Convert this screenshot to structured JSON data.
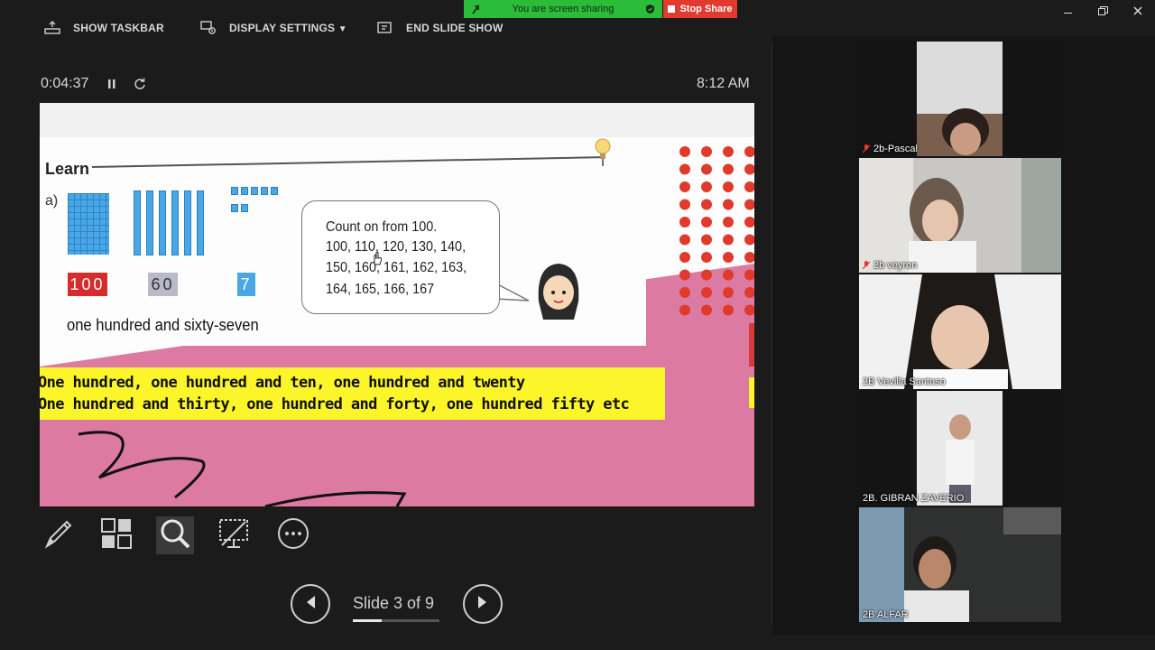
{
  "toolbar": {
    "show_taskbar": "SHOW TASKBAR",
    "display_settings": "DISPLAY SETTINGS",
    "display_settings_arrow": "▼",
    "end_slide_show": "END SLIDE SHOW"
  },
  "share": {
    "banner": "You are screen sharing",
    "stop": "Stop Share"
  },
  "timer": {
    "elapsed": "0:04:37",
    "clock": "8:12 AM"
  },
  "slide": {
    "learn": "Learn",
    "part": "a)",
    "card_hundreds": "100",
    "card_tens": "60",
    "card_ones": "7",
    "number_words": "one hundred and sixty-seven",
    "bubble": [
      "Count on from 100.",
      "100, 110, 120, 130, 140,",
      "150, 160, 161, 162, 163,",
      "164, 165, 166, 167"
    ],
    "banner_lines": [
      "One hundred, one hundred and ten, one hundred and twenty",
      "One hundred and thirty, one hundred and forty, one hundred fifty etc"
    ],
    "colors": {
      "pink": "#dc7aa2",
      "yellow": "#fbf52a",
      "blocks": "#4aa7e6"
    }
  },
  "controls": {
    "pen": "pen-icon",
    "grid": "see-all-slides-icon",
    "zoom": "zoom-icon",
    "screen": "screen-off-icon",
    "more": "more-options-icon"
  },
  "navigation": {
    "slide_label": "Slide 3 of 9",
    "current": 3,
    "total": 9
  },
  "participants": [
    {
      "name": "2b-Pascal",
      "muted": true
    },
    {
      "name": "2b veyron",
      "muted": true
    },
    {
      "name": "2B Vevilla Santoso",
      "muted": false
    },
    {
      "name": "2B. GIBRAN ZAVERIO",
      "muted": false
    },
    {
      "name": "2B  ALFAR",
      "muted": false
    }
  ]
}
